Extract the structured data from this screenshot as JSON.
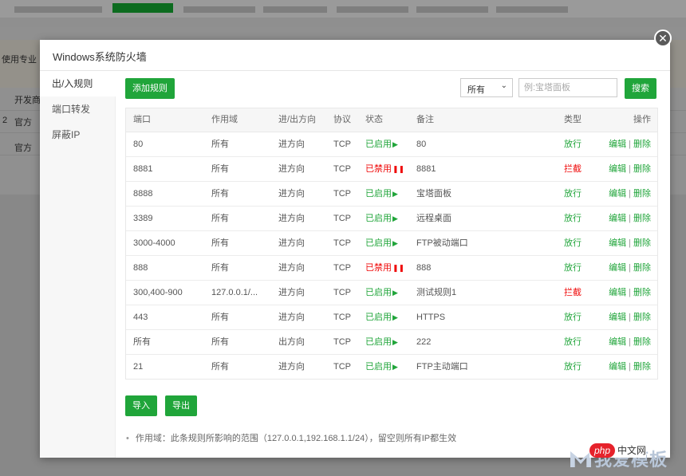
{
  "background": {
    "banner_text": "使用专业",
    "rows": [
      {
        "a": "开发商",
        "b": ""
      },
      {
        "a": "官方",
        "b": "2"
      },
      {
        "a": "官方",
        "b": ""
      }
    ]
  },
  "modal": {
    "title": "Windows系统防火墙",
    "close_glyph": "✕",
    "nav": [
      {
        "label": "出/入规则",
        "active": true
      },
      {
        "label": "端口转发",
        "active": false
      },
      {
        "label": "屏蔽IP",
        "active": false
      }
    ],
    "toolbar": {
      "add_rule_label": "添加规则",
      "filter_value": "所有",
      "filter_chevron": "⌄",
      "search_placeholder": "例:宝塔面板",
      "search_value": "",
      "search_label": "搜索"
    },
    "table": {
      "headers": {
        "port": "端口",
        "scope": "作用域",
        "direction": "进/出方向",
        "protocol": "协议",
        "status": "状态",
        "note": "备注",
        "type": "类型",
        "ops": "操作"
      },
      "rows": [
        {
          "port": "80",
          "scope": "所有",
          "direction": "进方向",
          "protocol": "TCP",
          "status": "已启用",
          "status_icon": "▶",
          "enabled": true,
          "note": "80",
          "type": "放行",
          "allow": true
        },
        {
          "port": "8881",
          "scope": "所有",
          "direction": "进方向",
          "protocol": "TCP",
          "status": "已禁用",
          "status_icon": "❚❚",
          "enabled": false,
          "note": "8881",
          "type": "拦截",
          "allow": false
        },
        {
          "port": "8888",
          "scope": "所有",
          "direction": "进方向",
          "protocol": "TCP",
          "status": "已启用",
          "status_icon": "▶",
          "enabled": true,
          "note": "宝塔面板",
          "type": "放行",
          "allow": true
        },
        {
          "port": "3389",
          "scope": "所有",
          "direction": "进方向",
          "protocol": "TCP",
          "status": "已启用",
          "status_icon": "▶",
          "enabled": true,
          "note": "远程桌面",
          "type": "放行",
          "allow": true
        },
        {
          "port": "3000-4000",
          "scope": "所有",
          "direction": "进方向",
          "protocol": "TCP",
          "status": "已启用",
          "status_icon": "▶",
          "enabled": true,
          "note": "FTP被动端口",
          "type": "放行",
          "allow": true
        },
        {
          "port": "888",
          "scope": "所有",
          "direction": "进方向",
          "protocol": "TCP",
          "status": "已禁用",
          "status_icon": "❚❚",
          "enabled": false,
          "note": "888",
          "type": "放行",
          "allow": true
        },
        {
          "port": "300,400-900",
          "scope": "127.0.0.1/...",
          "direction": "进方向",
          "protocol": "TCP",
          "status": "已启用",
          "status_icon": "▶",
          "enabled": true,
          "note": "测试规则1",
          "type": "拦截",
          "allow": false
        },
        {
          "port": "443",
          "scope": "所有",
          "direction": "进方向",
          "protocol": "TCP",
          "status": "已启用",
          "status_icon": "▶",
          "enabled": true,
          "note": "HTTPS",
          "type": "放行",
          "allow": true
        },
        {
          "port": "所有",
          "scope": "所有",
          "direction": "出方向",
          "protocol": "TCP",
          "status": "已启用",
          "status_icon": "▶",
          "enabled": true,
          "note": "222",
          "type": "放行",
          "allow": true
        },
        {
          "port": "21",
          "scope": "所有",
          "direction": "进方向",
          "protocol": "TCP",
          "status": "已启用",
          "status_icon": "▶",
          "enabled": true,
          "note": "FTP主动端口",
          "type": "放行",
          "allow": true
        }
      ],
      "op_edit": "编辑",
      "op_sep": "|",
      "op_delete": "删除"
    },
    "import_label": "导入",
    "export_label": "导出",
    "tip_bullet": "•",
    "tip_text": "作用域：此条规则所影响的范围（127.0.0.1,192.168.1.1/24），留空则所有IP都生效"
  },
  "watermarks": {
    "site_logo_text": "我爱模板",
    "php_badge": "php",
    "php_text": "中文网"
  },
  "colors": {
    "accent_green": "#20a53a",
    "danger_red": "#ef0808"
  }
}
